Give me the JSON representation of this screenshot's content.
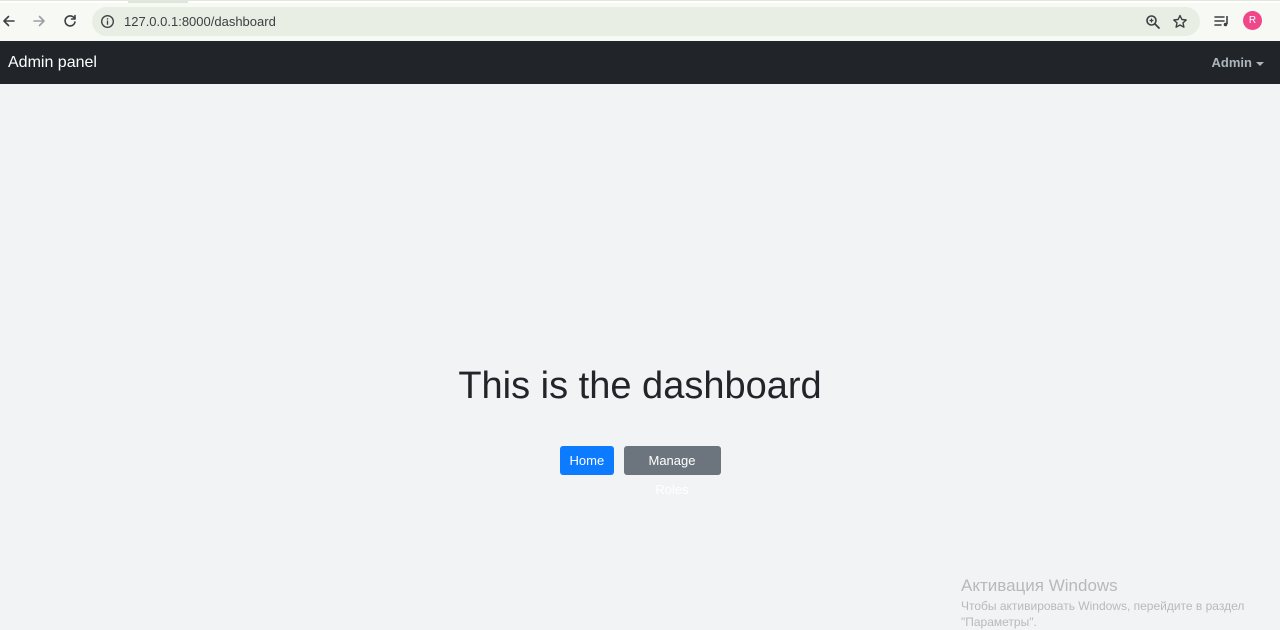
{
  "browser": {
    "url": "127.0.0.1:8000/dashboard",
    "profile_initial": "R",
    "icons": [
      "back-arrow-icon",
      "forward-arrow-icon",
      "reload-icon",
      "info-icon",
      "zoom-icon",
      "bookmark-star-icon",
      "reading-list-icon"
    ]
  },
  "navbar": {
    "brand": "Admin panel",
    "user_menu": "Admin"
  },
  "main": {
    "heading": "This is the dashboard",
    "buttons": {
      "home": "Home",
      "manage_roles": "Manage Roles"
    }
  },
  "watermark": {
    "title": "Активация Windows",
    "subtitle": "Чтобы активировать Windows, перейдите в раздел \"Параметры\"."
  },
  "colors": {
    "navbar_bg": "#212529",
    "primary": "#0d7bff",
    "secondary": "#6c757d",
    "page_bg": "#f2f3f5"
  }
}
